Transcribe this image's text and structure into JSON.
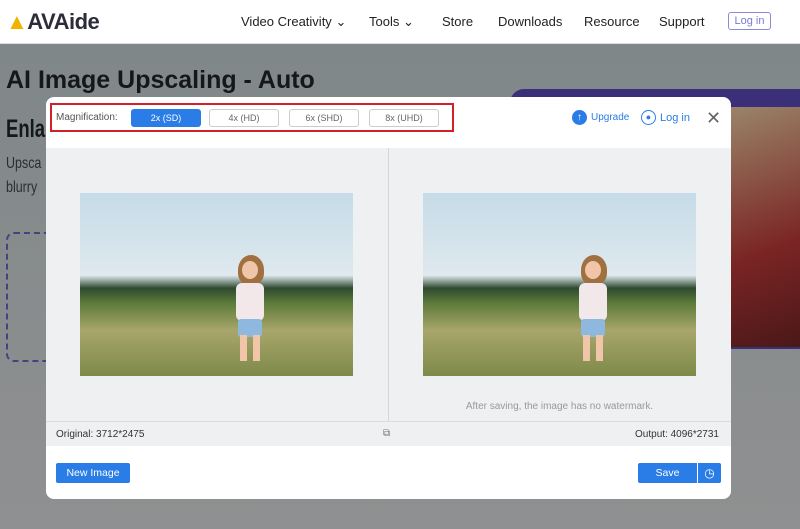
{
  "header": {
    "logo": "AVAide",
    "nav": [
      "Video Creativity",
      "Tools",
      "Store",
      "Downloads",
      "Resource",
      "Support"
    ],
    "login": "Log in"
  },
  "background": {
    "title_line1": "AI Image Upscaling - Auto",
    "title_line2": "Enla",
    "text_line1": "Upsca",
    "text_line2": "blurry"
  },
  "modal": {
    "magnification_label": "Magnification:",
    "options": [
      {
        "label": "2x (SD)",
        "selected": true
      },
      {
        "label": "4x (HD)",
        "selected": false
      },
      {
        "label": "6x (SHD)",
        "selected": false
      },
      {
        "label": "8x (UHD)",
        "selected": false
      }
    ],
    "upgrade": "Upgrade",
    "login": "Log in",
    "watermark_note": "After saving, the image has no watermark.",
    "original": "Original: 3712*2475",
    "output": "Output: 4096*2731",
    "new_image": "New Image",
    "save": "Save"
  },
  "colors": {
    "accent": "#2a7ce6",
    "highlight": "#d0202a"
  }
}
